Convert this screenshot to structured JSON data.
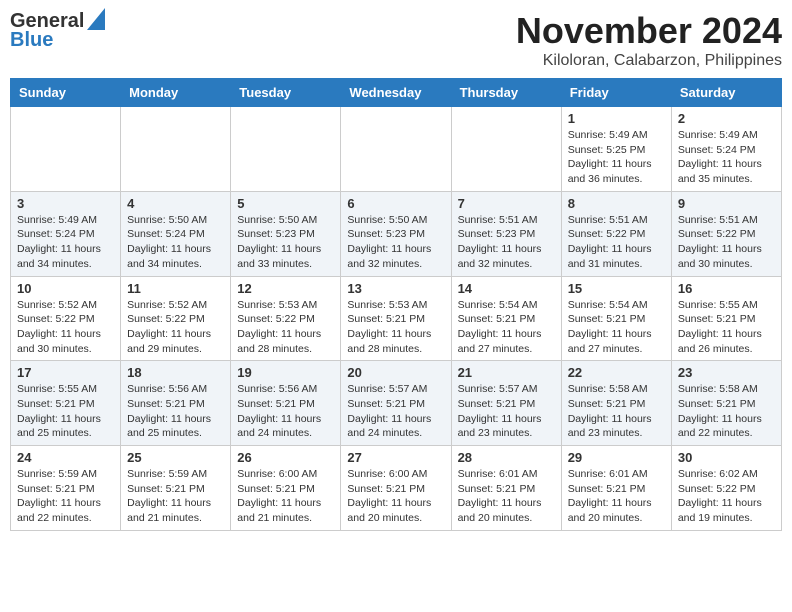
{
  "logo": {
    "line1": "General",
    "line2": "Blue"
  },
  "title": "November 2024",
  "subtitle": "Kiloloran, Calabarzon, Philippines",
  "weekdays": [
    "Sunday",
    "Monday",
    "Tuesday",
    "Wednesday",
    "Thursday",
    "Friday",
    "Saturday"
  ],
  "weeks": [
    [
      {
        "day": "",
        "info": ""
      },
      {
        "day": "",
        "info": ""
      },
      {
        "day": "",
        "info": ""
      },
      {
        "day": "",
        "info": ""
      },
      {
        "day": "",
        "info": ""
      },
      {
        "day": "1",
        "info": "Sunrise: 5:49 AM\nSunset: 5:25 PM\nDaylight: 11 hours\nand 36 minutes."
      },
      {
        "day": "2",
        "info": "Sunrise: 5:49 AM\nSunset: 5:24 PM\nDaylight: 11 hours\nand 35 minutes."
      }
    ],
    [
      {
        "day": "3",
        "info": "Sunrise: 5:49 AM\nSunset: 5:24 PM\nDaylight: 11 hours\nand 34 minutes."
      },
      {
        "day": "4",
        "info": "Sunrise: 5:50 AM\nSunset: 5:24 PM\nDaylight: 11 hours\nand 34 minutes."
      },
      {
        "day": "5",
        "info": "Sunrise: 5:50 AM\nSunset: 5:23 PM\nDaylight: 11 hours\nand 33 minutes."
      },
      {
        "day": "6",
        "info": "Sunrise: 5:50 AM\nSunset: 5:23 PM\nDaylight: 11 hours\nand 32 minutes."
      },
      {
        "day": "7",
        "info": "Sunrise: 5:51 AM\nSunset: 5:23 PM\nDaylight: 11 hours\nand 32 minutes."
      },
      {
        "day": "8",
        "info": "Sunrise: 5:51 AM\nSunset: 5:22 PM\nDaylight: 11 hours\nand 31 minutes."
      },
      {
        "day": "9",
        "info": "Sunrise: 5:51 AM\nSunset: 5:22 PM\nDaylight: 11 hours\nand 30 minutes."
      }
    ],
    [
      {
        "day": "10",
        "info": "Sunrise: 5:52 AM\nSunset: 5:22 PM\nDaylight: 11 hours\nand 30 minutes."
      },
      {
        "day": "11",
        "info": "Sunrise: 5:52 AM\nSunset: 5:22 PM\nDaylight: 11 hours\nand 29 minutes."
      },
      {
        "day": "12",
        "info": "Sunrise: 5:53 AM\nSunset: 5:22 PM\nDaylight: 11 hours\nand 28 minutes."
      },
      {
        "day": "13",
        "info": "Sunrise: 5:53 AM\nSunset: 5:21 PM\nDaylight: 11 hours\nand 28 minutes."
      },
      {
        "day": "14",
        "info": "Sunrise: 5:54 AM\nSunset: 5:21 PM\nDaylight: 11 hours\nand 27 minutes."
      },
      {
        "day": "15",
        "info": "Sunrise: 5:54 AM\nSunset: 5:21 PM\nDaylight: 11 hours\nand 27 minutes."
      },
      {
        "day": "16",
        "info": "Sunrise: 5:55 AM\nSunset: 5:21 PM\nDaylight: 11 hours\nand 26 minutes."
      }
    ],
    [
      {
        "day": "17",
        "info": "Sunrise: 5:55 AM\nSunset: 5:21 PM\nDaylight: 11 hours\nand 25 minutes."
      },
      {
        "day": "18",
        "info": "Sunrise: 5:56 AM\nSunset: 5:21 PM\nDaylight: 11 hours\nand 25 minutes."
      },
      {
        "day": "19",
        "info": "Sunrise: 5:56 AM\nSunset: 5:21 PM\nDaylight: 11 hours\nand 24 minutes."
      },
      {
        "day": "20",
        "info": "Sunrise: 5:57 AM\nSunset: 5:21 PM\nDaylight: 11 hours\nand 24 minutes."
      },
      {
        "day": "21",
        "info": "Sunrise: 5:57 AM\nSunset: 5:21 PM\nDaylight: 11 hours\nand 23 minutes."
      },
      {
        "day": "22",
        "info": "Sunrise: 5:58 AM\nSunset: 5:21 PM\nDaylight: 11 hours\nand 23 minutes."
      },
      {
        "day": "23",
        "info": "Sunrise: 5:58 AM\nSunset: 5:21 PM\nDaylight: 11 hours\nand 22 minutes."
      }
    ],
    [
      {
        "day": "24",
        "info": "Sunrise: 5:59 AM\nSunset: 5:21 PM\nDaylight: 11 hours\nand 22 minutes."
      },
      {
        "day": "25",
        "info": "Sunrise: 5:59 AM\nSunset: 5:21 PM\nDaylight: 11 hours\nand 21 minutes."
      },
      {
        "day": "26",
        "info": "Sunrise: 6:00 AM\nSunset: 5:21 PM\nDaylight: 11 hours\nand 21 minutes."
      },
      {
        "day": "27",
        "info": "Sunrise: 6:00 AM\nSunset: 5:21 PM\nDaylight: 11 hours\nand 20 minutes."
      },
      {
        "day": "28",
        "info": "Sunrise: 6:01 AM\nSunset: 5:21 PM\nDaylight: 11 hours\nand 20 minutes."
      },
      {
        "day": "29",
        "info": "Sunrise: 6:01 AM\nSunset: 5:21 PM\nDaylight: 11 hours\nand 20 minutes."
      },
      {
        "day": "30",
        "info": "Sunrise: 6:02 AM\nSunset: 5:22 PM\nDaylight: 11 hours\nand 19 minutes."
      }
    ]
  ]
}
